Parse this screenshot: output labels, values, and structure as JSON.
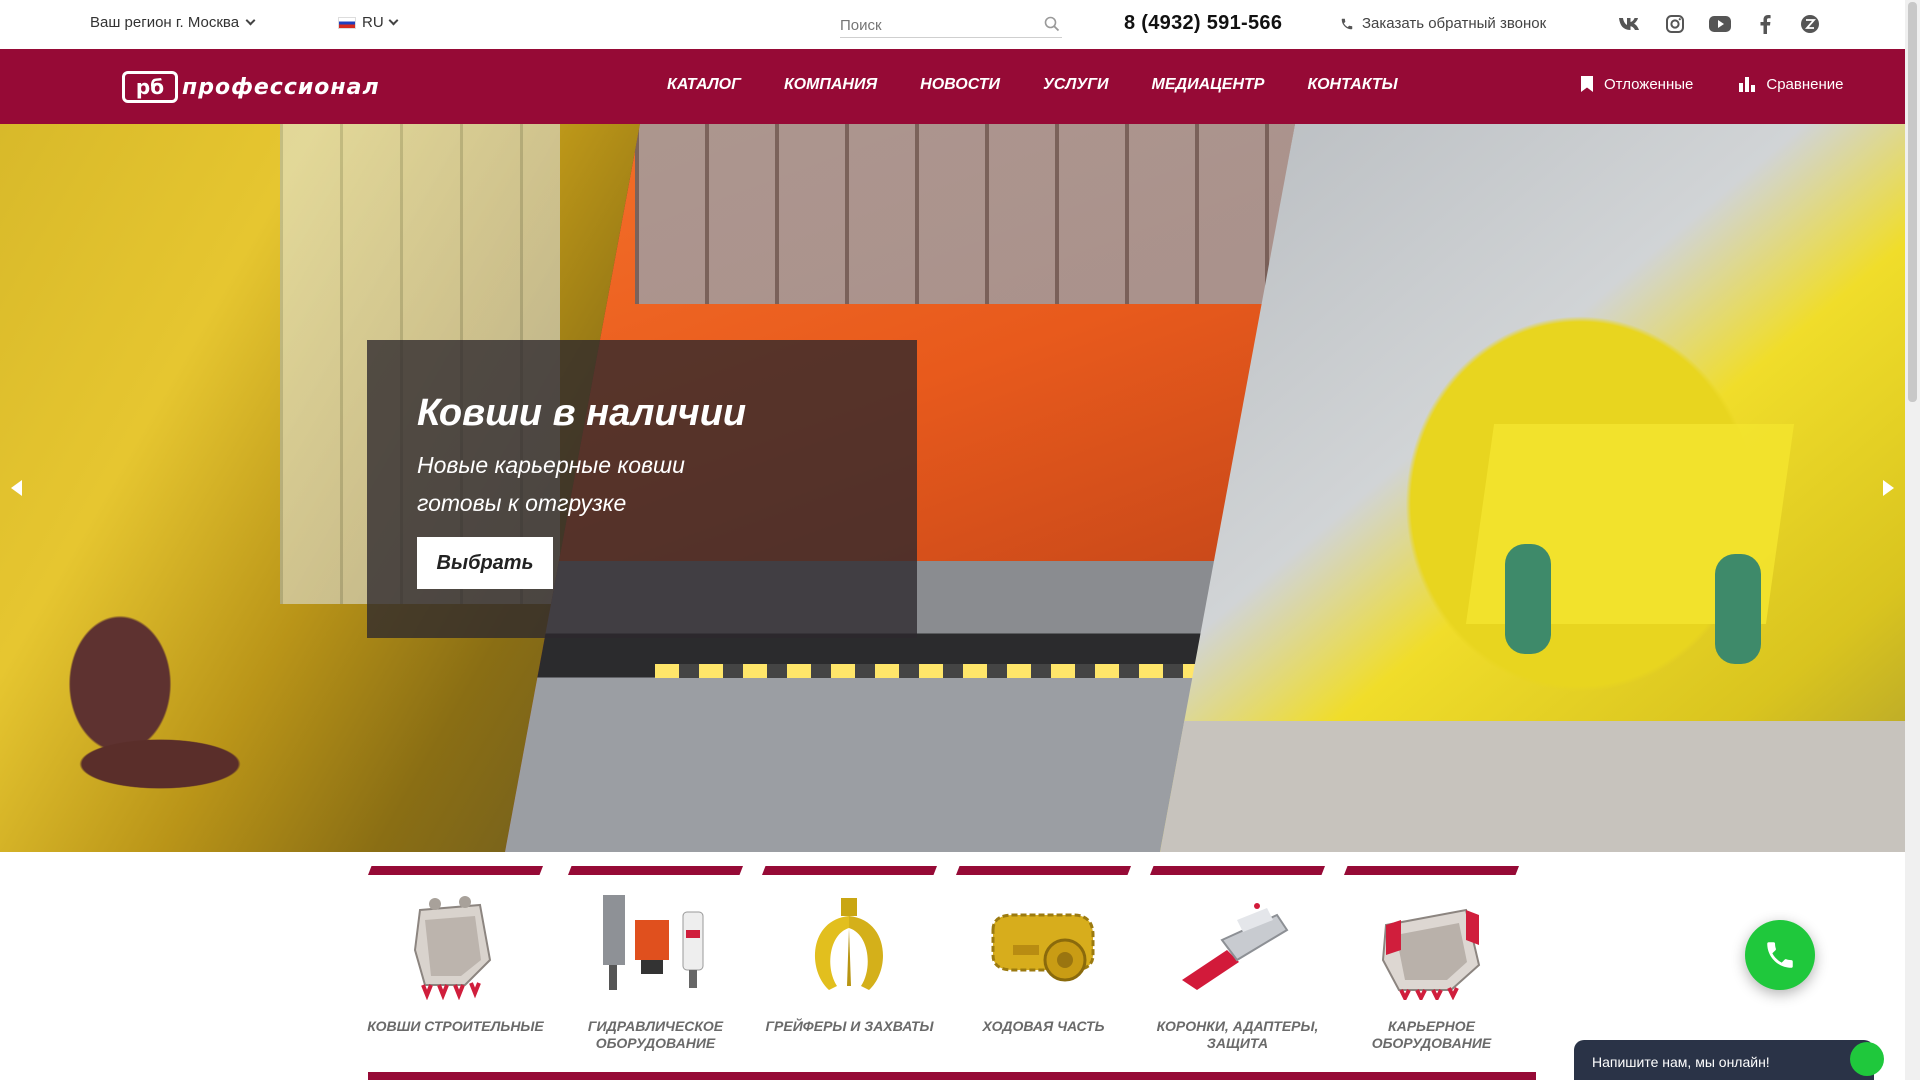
{
  "topbar": {
    "region_label": "Ваш регион г. Москва",
    "lang": "RU",
    "search_placeholder": "Поиск",
    "phone": "8 (4932) 591-566",
    "callback_label": "Заказать обратный звонок",
    "socials": [
      "vk-icon",
      "instagram-icon",
      "youtube-icon",
      "facebook-icon",
      "zen-icon"
    ]
  },
  "nav": {
    "logo_mark": "рб",
    "logo_text": "профессионал",
    "links": [
      "КАТАЛОГ",
      "КОМПАНИЯ",
      "НОВОСТИ",
      "УСЛУГИ",
      "МЕДИАЦЕНТР",
      "КОНТАКТЫ"
    ],
    "saved_label": "Отложенные",
    "compare_label": "Сравнение"
  },
  "hero": {
    "title": "Ковши в наличии",
    "subtitle": "Новые карьерные ковши готовы к отгрузке",
    "button_label": "Выбрать"
  },
  "categories": [
    {
      "label": "КОВШИ СТРОИТЕЛЬНЫЕ",
      "icon": "construction-bucket-icon"
    },
    {
      "label": "ГИДРАВЛИЧЕСКОЕ ОБОРУДОВАНИЕ",
      "icon": "hydraulic-equipment-icon"
    },
    {
      "label": "ГРЕЙФЕРЫ И ЗАХВАТЫ",
      "icon": "grapple-icon"
    },
    {
      "label": "ХОДОВАЯ ЧАСТЬ",
      "icon": "undercarriage-icon"
    },
    {
      "label": "КОРОНКИ, АДАПТЕРЫ, ЗАЩИТА",
      "icon": "teeth-adapters-icon"
    },
    {
      "label": "КАРЬЕРНОЕ ОБОРУДОВАНИЕ",
      "icon": "mining-bucket-icon"
    }
  ],
  "chat": {
    "label": "Напишите нам, мы онлайн!"
  },
  "colors": {
    "brand": "#960a36",
    "call_button": "#1fc83c",
    "chat_bg": "#2a3347"
  }
}
